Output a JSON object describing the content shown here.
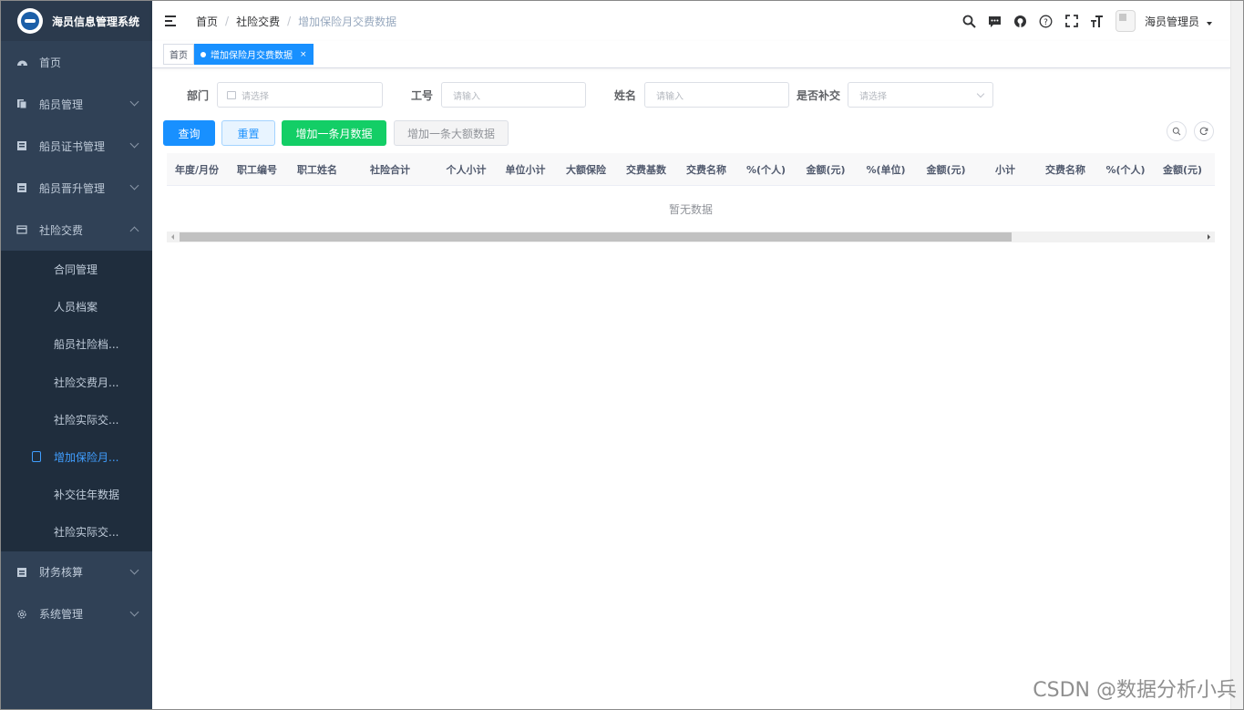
{
  "app": {
    "title": "海员信息管理系统"
  },
  "sidebar": {
    "items": [
      {
        "label": "首页",
        "icon": "dashboard-icon"
      },
      {
        "label": "船员管理",
        "icon": "documents-icon"
      },
      {
        "label": "船员证书管理",
        "icon": "certificate-icon"
      },
      {
        "label": "船员晋升管理",
        "icon": "promotion-icon"
      },
      {
        "label": "社险交费",
        "icon": "insurance-icon",
        "expanded": true
      },
      {
        "label": "财务核算",
        "icon": "finance-icon"
      },
      {
        "label": "系统管理",
        "icon": "settings-icon"
      }
    ],
    "submenu": [
      {
        "label": "合同管理"
      },
      {
        "label": "人员档案"
      },
      {
        "label": "船员社险档..."
      },
      {
        "label": "社险交费月..."
      },
      {
        "label": "社险实际交..."
      },
      {
        "label": "增加保险月...",
        "active": true
      },
      {
        "label": "补交往年数据"
      },
      {
        "label": "社险实际交..."
      }
    ]
  },
  "breadcrumb": {
    "home": "首页",
    "section": "社险交费",
    "current": "增加保险月交费数据"
  },
  "user": {
    "name": "海员管理员"
  },
  "tags": [
    {
      "label": "首页",
      "active": false
    },
    {
      "label": "增加保险月交费数据",
      "active": true,
      "close": "×"
    }
  ],
  "filters": {
    "department": {
      "label": "部门",
      "placeholder": "请选择"
    },
    "staff_no": {
      "label": "工号",
      "placeholder": "请输入"
    },
    "name": {
      "label": "姓名",
      "placeholder": "请输入"
    },
    "makeup": {
      "label": "是否补交",
      "placeholder": "请选择"
    }
  },
  "buttons": {
    "query": "查询",
    "reset": "重置",
    "add_month": "增加一条月数据",
    "add_large": "增加一条大额数据"
  },
  "table": {
    "columns": [
      "年度/月份",
      "职工编号",
      "职工姓名",
      "社险合计",
      "个人小计",
      "单位小计",
      "大额保险",
      "交费基数",
      "交费名称",
      "%(个人)",
      "金额(元)",
      "%(单位)",
      "金额(元)",
      "小计",
      "交费名称",
      "%(个人)",
      "金额(元)"
    ],
    "empty_text": "暂无数据"
  },
  "watermark": "CSDN @数据分析小兵",
  "colors": {
    "sidebar_bg": "#304156",
    "primary": "#1890ff",
    "success": "#13ce66"
  }
}
